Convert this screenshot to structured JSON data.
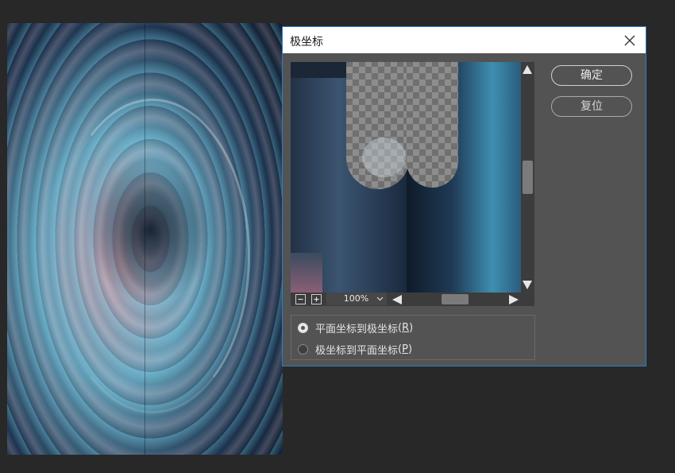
{
  "dialog": {
    "title": "极坐标",
    "ok_label": "确定",
    "reset_label": "复位"
  },
  "preview": {
    "zoom": "100%"
  },
  "options": [
    {
      "label": "平面坐标到极坐标",
      "hotkey": "R",
      "checked": true
    },
    {
      "label": "极坐标到平面坐标",
      "hotkey": "P",
      "checked": false
    }
  ],
  "colors": {
    "dialog_bg": "#535353",
    "accent_border": "#2d7fc7",
    "workspace_bg": "#282828"
  }
}
